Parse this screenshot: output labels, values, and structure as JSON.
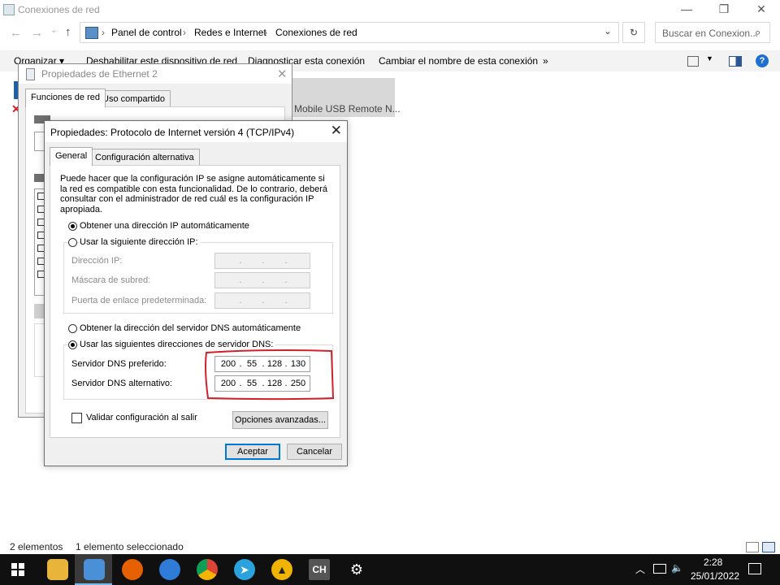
{
  "window": {
    "title": "Conexiones de red",
    "controls": [
      "—",
      "❐",
      "✕"
    ]
  },
  "addressbar": {
    "crumbs": [
      "Panel de control",
      "Redes e Internet",
      "Conexiones de red"
    ],
    "search_placeholder": "Buscar en Conexion..."
  },
  "commandbar": {
    "items": [
      "Organizar ▾",
      "Deshabilitar este dispositivo de red",
      "Diagnosticar esta conexión",
      "Cambiar el nombre de esta conexión",
      "»"
    ]
  },
  "adapter_tile": {
    "label": "Mobile USB Remote N..."
  },
  "ethernet_dialog": {
    "title": "Propiedades de Ethernet 2",
    "tabs": [
      "Funciones de red",
      "Uso compartido"
    ]
  },
  "ipv4_dialog": {
    "title": "Propiedades: Protocolo de Internet versión 4 (TCP/IPv4)",
    "tabs": [
      "General",
      "Configuración alternativa"
    ],
    "description": "Puede hacer que la configuración IP se asigne automáticamente si la red es compatible con esta funcionalidad. De lo contrario, deberá consultar con el administrador de red cuál es la configuración IP apropiada.",
    "ip_auto_label": "Obtener una dirección IP automáticamente",
    "ip_manual_label": "Usar la siguiente dirección IP:",
    "ip_fields": [
      {
        "label": "Dirección IP:"
      },
      {
        "label": "Máscara de subred:"
      },
      {
        "label": "Puerta de enlace predeterminada:"
      }
    ],
    "dns_auto_label": "Obtener la dirección del servidor DNS automáticamente",
    "dns_manual_label": "Usar las siguientes direcciones de servidor DNS:",
    "dns_preferred": {
      "label": "Servidor DNS preferido:",
      "octets": [
        "200",
        "55",
        "128",
        "130"
      ]
    },
    "dns_alternate": {
      "label": "Servidor DNS alternativo:",
      "octets": [
        "200",
        "55",
        "128",
        "250"
      ]
    },
    "validate_label": "Validar configuración al salir",
    "advanced_button": "Opciones avanzadas...",
    "ok_button": "Aceptar",
    "cancel_button": "Cancelar",
    "highlight_color": "#d0202a"
  },
  "statusbar": {
    "items_count": "2 elementos",
    "selected": "1 elemento seleccionado"
  },
  "taskbar": {
    "time": "2:28",
    "date": "25/01/2022"
  }
}
